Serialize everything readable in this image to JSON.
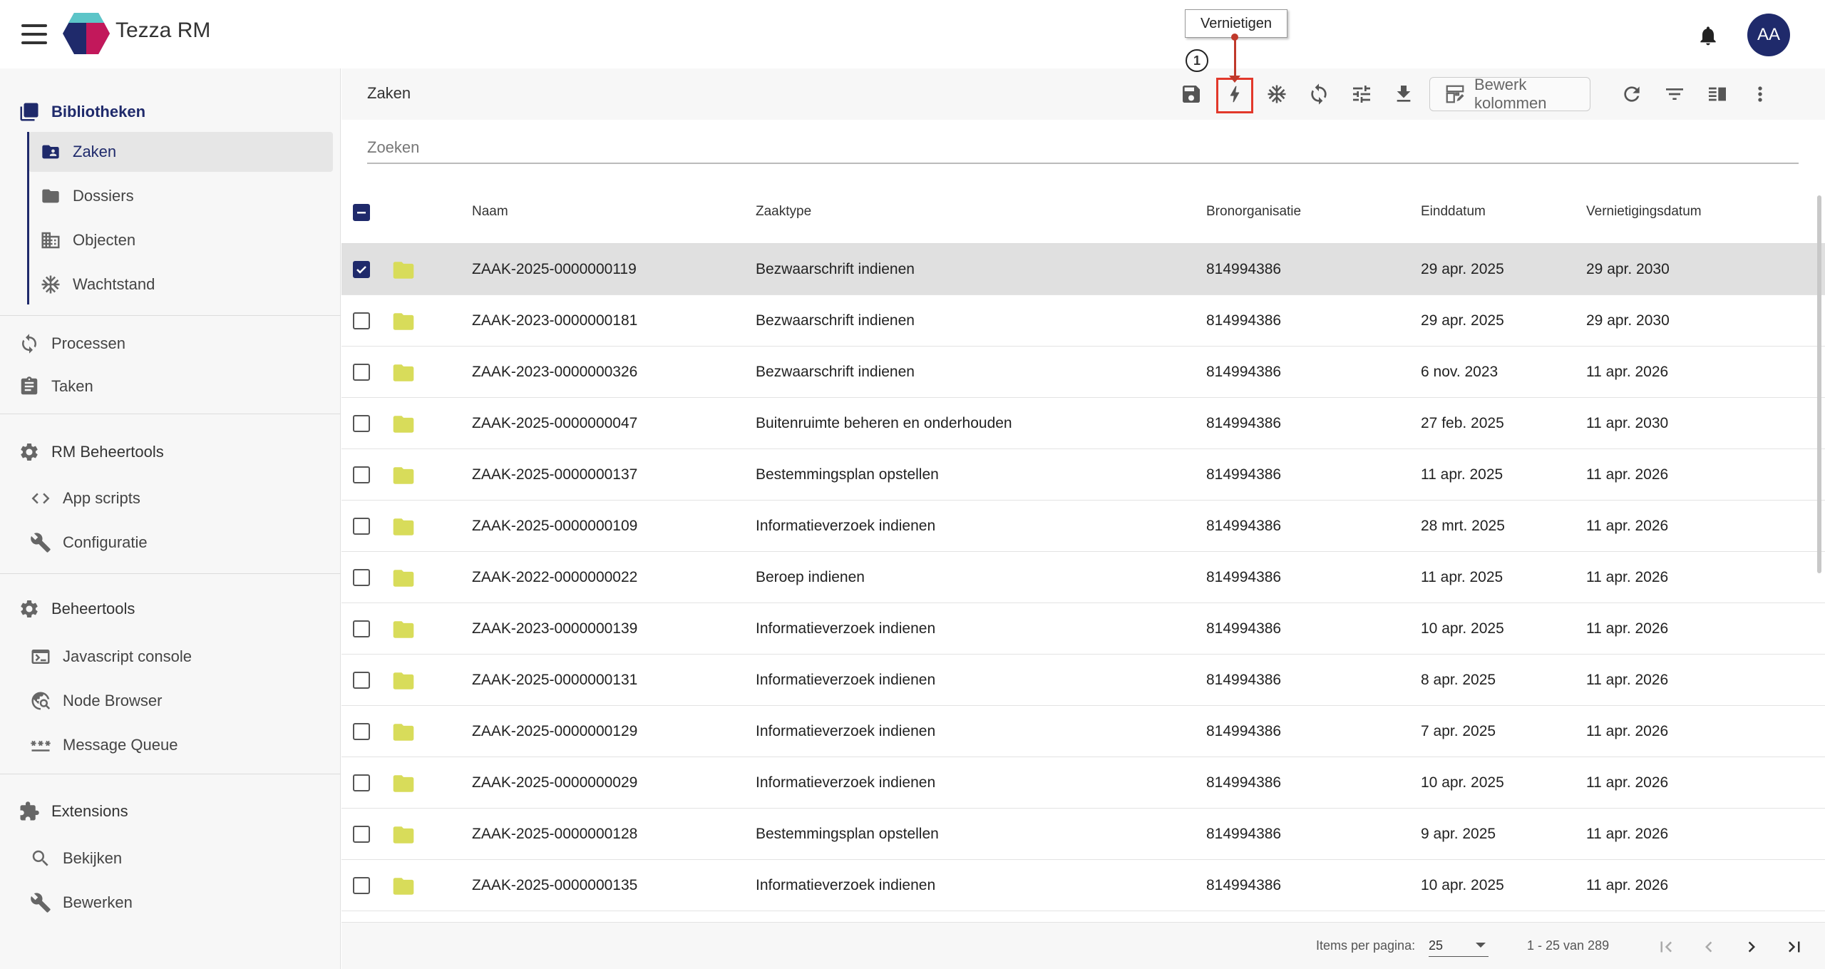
{
  "app": {
    "title": "Tezza RM",
    "user_initials": "AA",
    "accent": "#1f2a6b"
  },
  "sidebar": {
    "bibliotheken": "Bibliotheken",
    "zaken": "Zaken",
    "dossiers": "Dossiers",
    "objecten": "Objecten",
    "wachtstand": "Wachtstand",
    "processen": "Processen",
    "taken": "Taken",
    "rm_beheertools": "RM Beheertools",
    "app_scripts": "App scripts",
    "configuratie_rm": "Configuratie",
    "beheertools": "Beheertools",
    "javascript_console": "Javascript console",
    "node_browser": "Node Browser",
    "message_queue": "Message Queue",
    "extensions": "Extensions",
    "bekijken": "Bekijken",
    "bewerken": "Bewerken"
  },
  "toolbar": {
    "title": "Zaken",
    "bewerk_kolommen": "Bewerk kolommen",
    "tooltip": "Vernietigen",
    "marker": "1",
    "highlight_color": "#e2382b"
  },
  "search": {
    "placeholder": "Zoeken"
  },
  "table": {
    "headers": {
      "naam": "Naam",
      "zaaktype": "Zaaktype",
      "bronorganisatie": "Bronorganisatie",
      "einddatum": "Einddatum",
      "vernietigingsdatum": "Vernietigingsdatum"
    },
    "rows": [
      {
        "naam": "ZAAK-2025-0000000119",
        "zaaktype": "Bezwaarschrift indienen",
        "bron": "814994386",
        "eind": "29 apr. 2025",
        "vern": "29 apr. 2030",
        "selected": true
      },
      {
        "naam": "ZAAK-2023-0000000181",
        "zaaktype": "Bezwaarschrift indienen",
        "bron": "814994386",
        "eind": "29 apr. 2025",
        "vern": "29 apr. 2030",
        "selected": false
      },
      {
        "naam": "ZAAK-2023-0000000326",
        "zaaktype": "Bezwaarschrift indienen",
        "bron": "814994386",
        "eind": "6 nov. 2023",
        "vern": "11 apr. 2026",
        "selected": false
      },
      {
        "naam": "ZAAK-2025-0000000047",
        "zaaktype": "Buitenruimte beheren en onderhouden",
        "bron": "814994386",
        "eind": "27 feb. 2025",
        "vern": "11 apr. 2030",
        "selected": false
      },
      {
        "naam": "ZAAK-2025-0000000137",
        "zaaktype": "Bestemmingsplan opstellen",
        "bron": "814994386",
        "eind": "11 apr. 2025",
        "vern": "11 apr. 2026",
        "selected": false
      },
      {
        "naam": "ZAAK-2025-0000000109",
        "zaaktype": "Informatieverzoek indienen",
        "bron": "814994386",
        "eind": "28 mrt. 2025",
        "vern": "11 apr. 2026",
        "selected": false
      },
      {
        "naam": "ZAAK-2022-0000000022",
        "zaaktype": "Beroep indienen",
        "bron": "814994386",
        "eind": "11 apr. 2025",
        "vern": "11 apr. 2026",
        "selected": false
      },
      {
        "naam": "ZAAK-2023-0000000139",
        "zaaktype": "Informatieverzoek indienen",
        "bron": "814994386",
        "eind": "10 apr. 2025",
        "vern": "11 apr. 2026",
        "selected": false
      },
      {
        "naam": "ZAAK-2025-0000000131",
        "zaaktype": "Informatieverzoek indienen",
        "bron": "814994386",
        "eind": "8 apr. 2025",
        "vern": "11 apr. 2026",
        "selected": false
      },
      {
        "naam": "ZAAK-2025-0000000129",
        "zaaktype": "Informatieverzoek indienen",
        "bron": "814994386",
        "eind": "7 apr. 2025",
        "vern": "11 apr. 2026",
        "selected": false
      },
      {
        "naam": "ZAAK-2025-0000000029",
        "zaaktype": "Informatieverzoek indienen",
        "bron": "814994386",
        "eind": "10 apr. 2025",
        "vern": "11 apr. 2026",
        "selected": false
      },
      {
        "naam": "ZAAK-2025-0000000128",
        "zaaktype": "Bestemmingsplan opstellen",
        "bron": "814994386",
        "eind": "9 apr. 2025",
        "vern": "11 apr. 2026",
        "selected": false
      },
      {
        "naam": "ZAAK-2025-0000000135",
        "zaaktype": "Informatieverzoek indienen",
        "bron": "814994386",
        "eind": "10 apr. 2025",
        "vern": "11 apr. 2026",
        "selected": false
      }
    ]
  },
  "pagination": {
    "items_label": "Items per pagina:",
    "page_size": "25",
    "range": "1 - 25 van 289"
  }
}
